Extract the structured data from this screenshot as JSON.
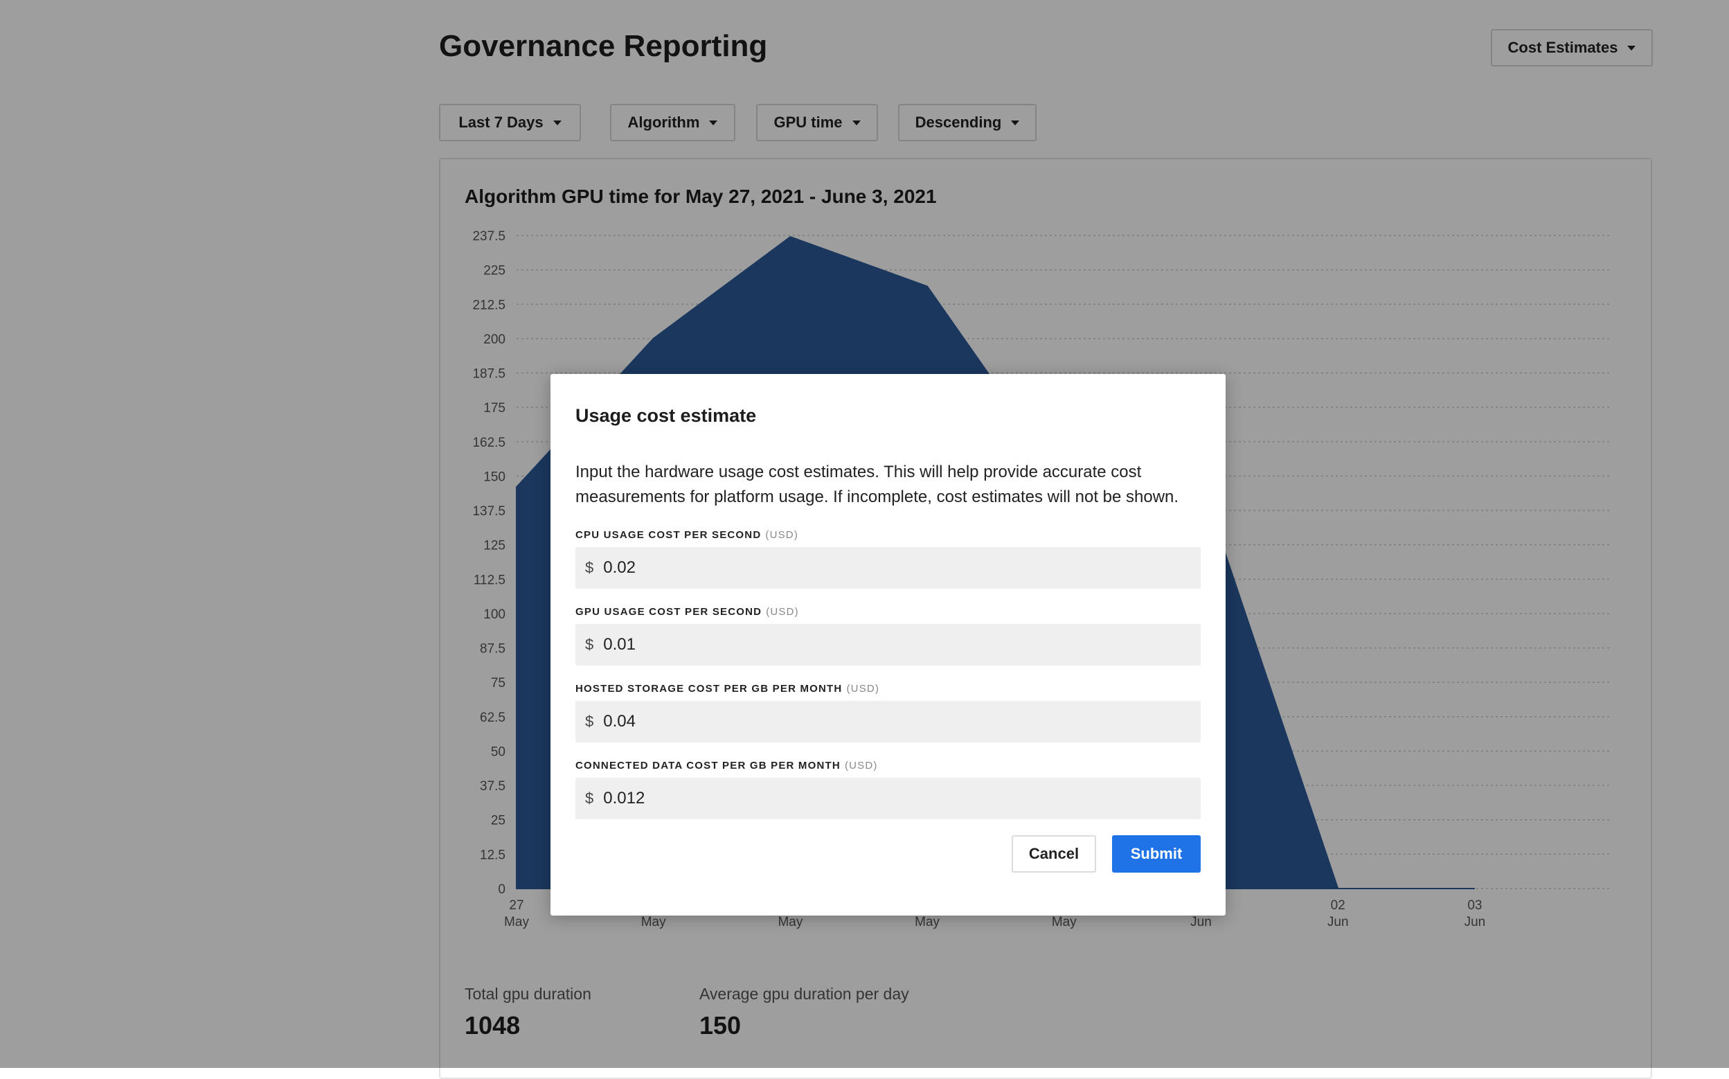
{
  "header": {
    "title": "Governance Reporting",
    "cost_estimates_label": "Cost Estimates"
  },
  "filters": [
    {
      "label": "Last 7 Days"
    },
    {
      "label": "Algorithm"
    },
    {
      "label": "GPU time"
    },
    {
      "label": "Descending"
    }
  ],
  "chart_data": {
    "type": "area",
    "title": "Algorithm GPU time for May 27, 2021 - June 3, 2021",
    "x": [
      "27 May",
      "28 May",
      "29 May",
      "30 May",
      "31 May",
      "01 Jun",
      "02 Jun",
      "03 Jun"
    ],
    "x_tick_labels": [
      {
        "day": "27",
        "month": "May"
      },
      {
        "day": "",
        "month": "May"
      },
      {
        "day": "",
        "month": "May"
      },
      {
        "day": "",
        "month": "May"
      },
      {
        "day": "",
        "month": "May"
      },
      {
        "day": "",
        "month": "Jun"
      },
      {
        "day": "02",
        "month": "Jun"
      },
      {
        "day": "03",
        "month": "Jun"
      }
    ],
    "y_ticks": [
      "0",
      "12.5",
      "25",
      "37.5",
      "50",
      "62.5",
      "75",
      "87.5",
      "100",
      "112.5",
      "125",
      "137.5",
      "150",
      "162.5",
      "175",
      "187.5",
      "200",
      "212.5",
      "225",
      "237.5"
    ],
    "series": [
      {
        "values": [
          146,
          200,
          237,
          219,
          148,
          148,
          0,
          0
        ]
      }
    ],
    "ylim": [
      0,
      237.5
    ],
    "color": "#2c5a96",
    "grid": true
  },
  "stats": {
    "total_label": "Total gpu duration",
    "total_value": "1048",
    "avg_label": "Average gpu duration per day",
    "avg_value": "150"
  },
  "modal": {
    "title": "Usage cost estimate",
    "description": "Input the hardware usage cost estimates. This will help provide accurate cost measurements for platform usage. If incomplete, cost estimates will not be shown.",
    "fields": [
      {
        "label": "CPU USAGE COST PER SECOND",
        "unit": "(USD)",
        "currency": "$",
        "value": "0.02"
      },
      {
        "label": "GPU USAGE COST PER SECOND",
        "unit": "(USD)",
        "currency": "$",
        "value": "0.01"
      },
      {
        "label": "HOSTED STORAGE COST PER GB PER MONTH",
        "unit": "(USD)",
        "currency": "$",
        "value": "0.04"
      },
      {
        "label": "CONNECTED DATA COST PER GB PER MONTH",
        "unit": "(USD)",
        "currency": "$",
        "value": "0.012"
      }
    ],
    "cancel_label": "Cancel",
    "submit_label": "Submit"
  }
}
